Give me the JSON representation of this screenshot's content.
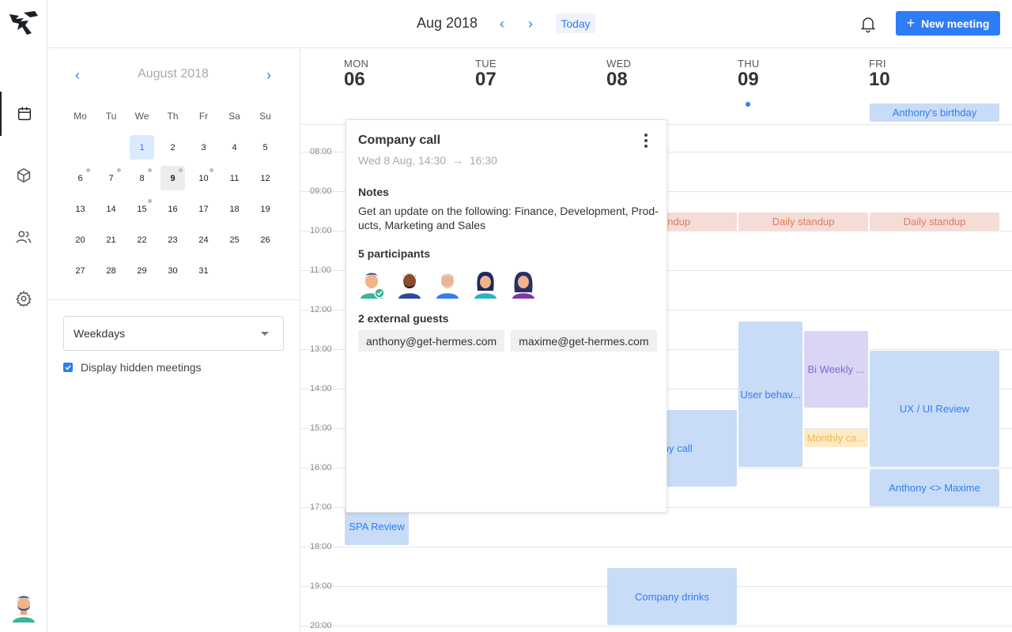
{
  "header": {
    "month_label": "Aug 2018",
    "today_label": "Today",
    "new_meeting_label": "New meeting"
  },
  "rail": {
    "items": [
      "calendar",
      "box",
      "people",
      "settings"
    ]
  },
  "mini_calendar": {
    "title": "August 2018",
    "weekday_headers": [
      "Mo",
      "Tu",
      "We",
      "Th",
      "Fr",
      "Sa",
      "Su"
    ],
    "weeks": [
      [
        "",
        "",
        "1",
        "2",
        "3",
        "4",
        "5"
      ],
      [
        "6",
        "7",
        "8",
        "9",
        "10",
        "11",
        "12"
      ],
      [
        "13",
        "14",
        "15",
        "16",
        "17",
        "18",
        "19"
      ],
      [
        "20",
        "21",
        "22",
        "23",
        "24",
        "25",
        "26"
      ],
      [
        "27",
        "28",
        "29",
        "30",
        "31",
        "",
        ""
      ]
    ],
    "today": "1",
    "selected": "9",
    "dots": [
      "6",
      "7",
      "8",
      "9",
      "10",
      "15"
    ]
  },
  "view_select": {
    "value": "Weekdays"
  },
  "display_hidden": {
    "label": "Display hidden meetings",
    "checked": true
  },
  "days": [
    {
      "name": "MON",
      "num": "06"
    },
    {
      "name": "TUE",
      "num": "07"
    },
    {
      "name": "WED",
      "num": "08"
    },
    {
      "name": "THU",
      "num": "09"
    },
    {
      "name": "FRI",
      "num": "10"
    }
  ],
  "hours": [
    "08:00",
    "09:00",
    "10:00",
    "11:00",
    "12:00",
    "13:00",
    "14:00",
    "15:00",
    "16:00",
    "17:00",
    "18:00",
    "19:00",
    "20:00"
  ],
  "events": {
    "birthday": "Anthony's birthday",
    "standup_wed": "standup",
    "standup_thu": "Daily standup",
    "standup_fri": "Daily standup",
    "user_behav": "User behav...",
    "bi_weekly": "Bi Weekly ...",
    "monthly": "Monthly ca...",
    "ux_review": "UX / UI Review",
    "anthony_maxime": "Anthony <> Maxime",
    "company_call_partial": "pany call",
    "spa_review": "SPA Review",
    "company_drinks": "Company drinks"
  },
  "popover": {
    "title": "Company call",
    "when_start": "Wed 8 Aug, 14:30",
    "when_end": "16:30",
    "notes_label": "Notes",
    "notes_text": "Get an update on the following: Finance, Development, Prod­ucts, Marketing and Sales",
    "participants_label": "5 participants",
    "guests_label": "2 external guests",
    "guests": [
      "anthony@get-hermes.com",
      "maxime@get-hermes.com"
    ]
  },
  "colors": {
    "accent": "#2f7df6",
    "event_blue": "#c8dcf7",
    "event_red": "#f6dcd6",
    "event_purple": "#d8d6f4",
    "event_yellow": "#fdebc8"
  }
}
